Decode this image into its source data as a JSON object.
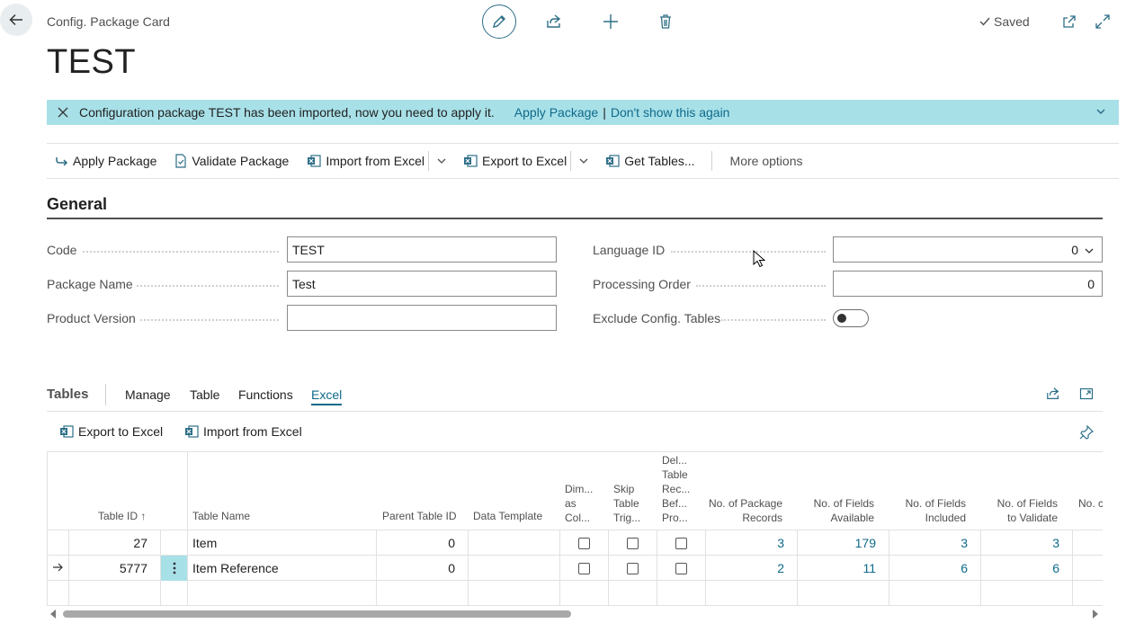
{
  "header": {
    "breadcrumb": "Config. Package Card",
    "saved_label": "Saved",
    "title": "TEST"
  },
  "banner": {
    "message": "Configuration package TEST has been imported, now you need to apply it.",
    "apply_link": "Apply Package",
    "separator": "|",
    "dismiss_link": "Don't show this again"
  },
  "actions": {
    "apply_package": "Apply Package",
    "validate_package": "Validate Package",
    "import_from_excel": "Import from Excel",
    "export_to_excel": "Export to Excel",
    "get_tables": "Get Tables...",
    "more_options": "More options"
  },
  "general": {
    "title": "General",
    "code_label": "Code",
    "code_value": "TEST",
    "package_name_label": "Package Name",
    "package_name_value": "Test",
    "product_version_label": "Product Version",
    "product_version_value": "",
    "language_id_label": "Language ID",
    "language_id_value": "0",
    "processing_order_label": "Processing Order",
    "processing_order_value": "0",
    "exclude_config_label": "Exclude Config. Tables",
    "exclude_config_value": false
  },
  "tables_part": {
    "title": "Tables",
    "tabs": [
      "Manage",
      "Table",
      "Functions",
      "Excel"
    ],
    "active_tab": "Excel",
    "sub_actions": {
      "export_to_excel": "Export to Excel",
      "import_from_excel": "Import from Excel"
    },
    "columns": {
      "table_id": "Table ID",
      "sort_arrow": "↑",
      "table_name": "Table Name",
      "parent_table_id": "Parent Table ID",
      "data_template": "Data Template",
      "dim_as_col": [
        "Dim...",
        "as",
        "Col..."
      ],
      "skip_table_trig": [
        "Skip",
        "Table",
        "Trig..."
      ],
      "del_table_rec": [
        "Del...",
        "Table",
        "Rec...",
        "Bef...",
        "Pro..."
      ],
      "no_package_records": [
        "No. of Package",
        "Records"
      ],
      "no_fields_available": [
        "No. of Fields",
        "Available"
      ],
      "no_fields_included": [
        "No. of Fields",
        "Included"
      ],
      "no_fields_to_validate": [
        "No. of Fields",
        "to Validate"
      ],
      "no_cut": "No. c"
    },
    "rows": [
      {
        "table_id": "27",
        "table_name": "Item",
        "parent_table_id": "0",
        "data_template": "",
        "package_records": "3",
        "fields_available": "179",
        "fields_included": "3",
        "fields_to_validate": "3"
      },
      {
        "table_id": "5777",
        "table_name": "Item Reference",
        "parent_table_id": "0",
        "data_template": "",
        "package_records": "2",
        "fields_available": "11",
        "fields_included": "6",
        "fields_to_validate": "6"
      }
    ]
  },
  "icons": [
    "back-arrow-icon",
    "pencil-icon",
    "share-icon",
    "plus-icon",
    "trash-icon",
    "check-icon",
    "open-new-window-icon",
    "expand-icon",
    "close-icon",
    "chevron-down-icon",
    "excel-icon",
    "pin-icon"
  ]
}
